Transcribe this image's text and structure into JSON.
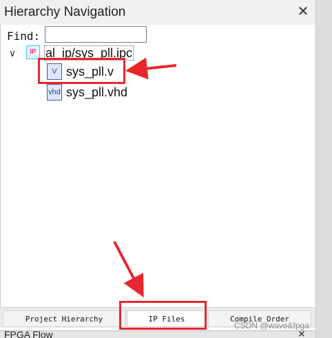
{
  "window": {
    "title": "Hierarchy Navigation",
    "close_symbol": "✕"
  },
  "find": {
    "label": "Find:",
    "value": ""
  },
  "tree": {
    "expander": "∨",
    "root": {
      "icon": "IP",
      "label": "al_ip/sys_pll.ipc"
    },
    "children": [
      {
        "icon": "V",
        "label": "sys_pll.v"
      },
      {
        "icon": "vhd",
        "label": "sys_pll.vhd"
      }
    ]
  },
  "tabs": [
    {
      "label": "Project Hierarchy",
      "active": false
    },
    {
      "label": "IP Files",
      "active": true
    },
    {
      "label": "Compile Order",
      "active": false
    }
  ],
  "next_panel": {
    "title": "FPGA Flow",
    "close_symbol": "✕"
  },
  "watermark": "CSDN @wave&fpga",
  "colors": {
    "highlight": "#e8262e",
    "title_bar": "#f0f0f0",
    "ip_icon_border": "#33c5ff",
    "ip_icon_text": "#ff2d78",
    "file_icon": "#4a5aa8"
  }
}
